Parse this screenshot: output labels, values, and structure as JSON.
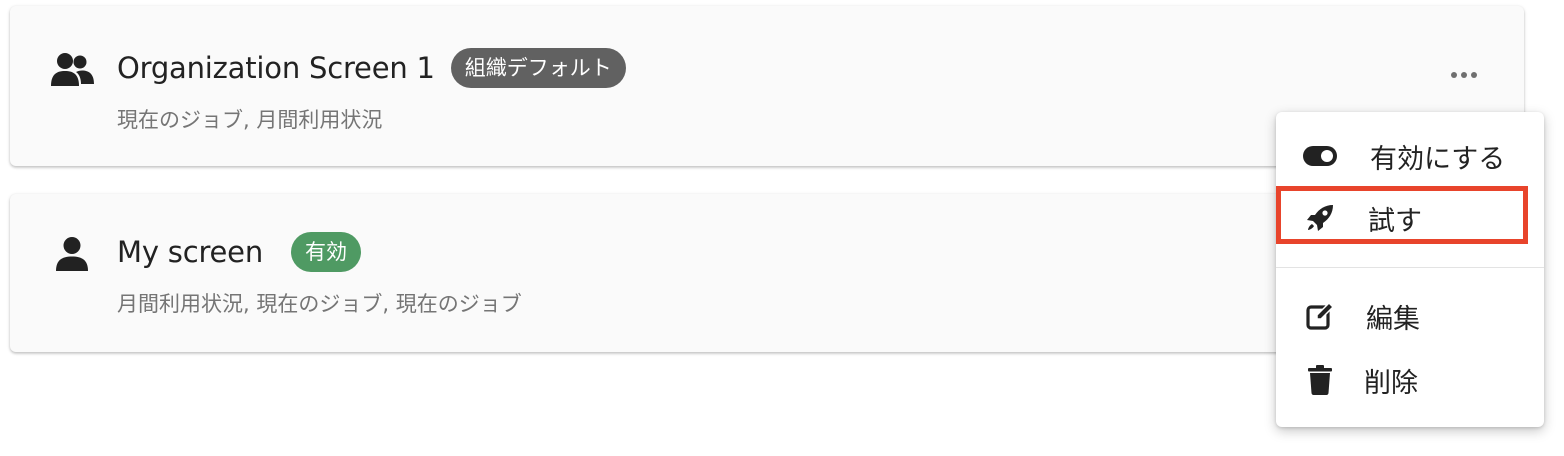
{
  "screens": [
    {
      "title": "Organization Screen 1",
      "badge": "組織デフォルト",
      "badge_color": "#616161",
      "subtitle": "現在のジョブ, 月間利用状況",
      "icon": "users-icon"
    },
    {
      "title": "My screen",
      "badge": "有効",
      "badge_color": "#4f9a63",
      "subtitle": "月間利用状況, 現在のジョブ, 現在のジョブ",
      "icon": "user-icon"
    }
  ],
  "context_menu": {
    "items": [
      {
        "label": "有効にする",
        "icon": "toggle-icon"
      },
      {
        "label": "試す",
        "icon": "rocket-icon"
      },
      {
        "label": "編集",
        "icon": "edit-icon"
      },
      {
        "label": "削除",
        "icon": "trash-icon"
      }
    ],
    "highlight_color": "#e8442b"
  },
  "more_button": {
    "icon": "more-horizontal-icon"
  }
}
